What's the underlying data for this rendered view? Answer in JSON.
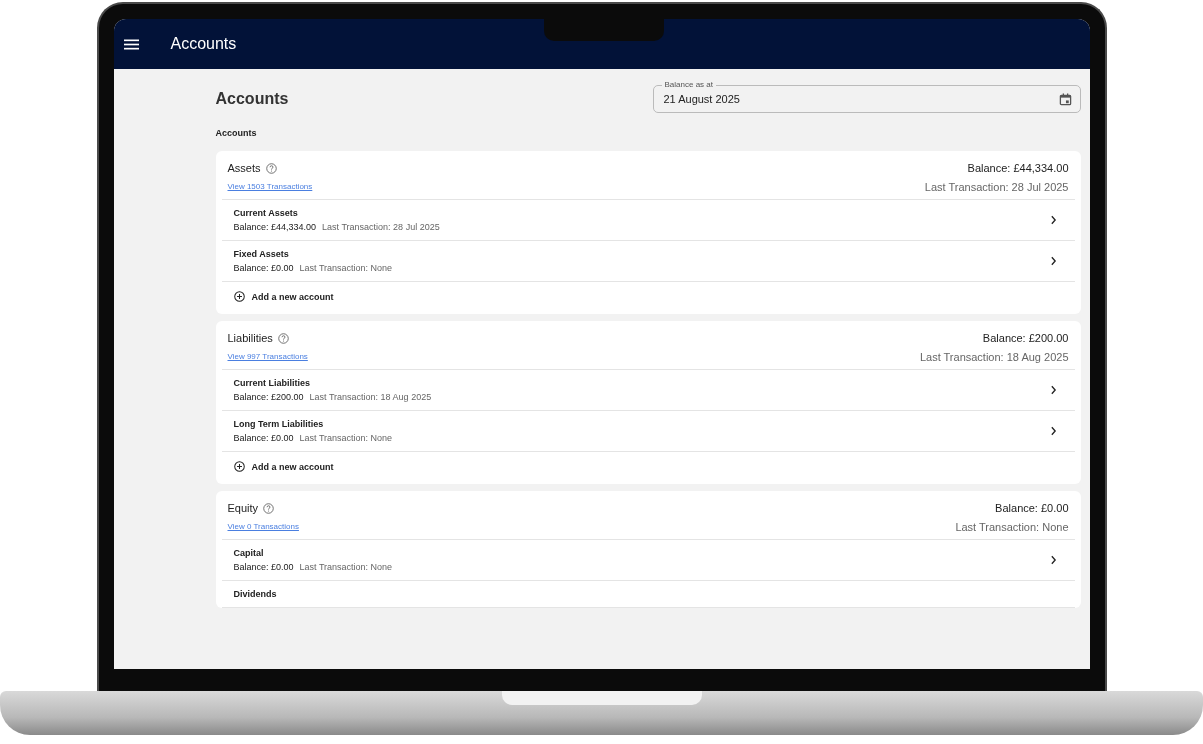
{
  "app_bar": {
    "title": "Accounts"
  },
  "page": {
    "title": "Accounts",
    "subtitle": "Accounts"
  },
  "date_field": {
    "label": "Balance as at",
    "value": "21 August 2025"
  },
  "groups": [
    {
      "name": "Assets",
      "link": "View 1503 Transactions",
      "balance": "Balance: £44,334.00",
      "last_transaction": "Last Transaction: 28 Jul 2025",
      "accounts": [
        {
          "name": "Current Assets",
          "balance": "Balance: £44,334.00",
          "last_transaction": "Last Transaction: 28 Jul 2025"
        },
        {
          "name": "Fixed Assets",
          "balance": "Balance: £0.00",
          "last_transaction": "Last Transaction: None"
        }
      ],
      "add_label": "Add a new account"
    },
    {
      "name": "Liabilities",
      "link": "View 997 Transactions",
      "balance": "Balance: £200.00",
      "last_transaction": "Last Transaction: 18 Aug 2025",
      "accounts": [
        {
          "name": "Current Liabilities",
          "balance": "Balance: £200.00",
          "last_transaction": "Last Transaction: 18 Aug 2025"
        },
        {
          "name": "Long Term Liabilities",
          "balance": "Balance: £0.00",
          "last_transaction": "Last Transaction: None"
        }
      ],
      "add_label": "Add a new account"
    },
    {
      "name": "Equity",
      "link": "View 0 Transactions",
      "balance": "Balance: £0.00",
      "last_transaction": "Last Transaction: None",
      "accounts": [
        {
          "name": "Capital",
          "balance": "Balance: £0.00",
          "last_transaction": "Last Transaction: None"
        },
        {
          "name": "Dividends"
        }
      ]
    }
  ]
}
